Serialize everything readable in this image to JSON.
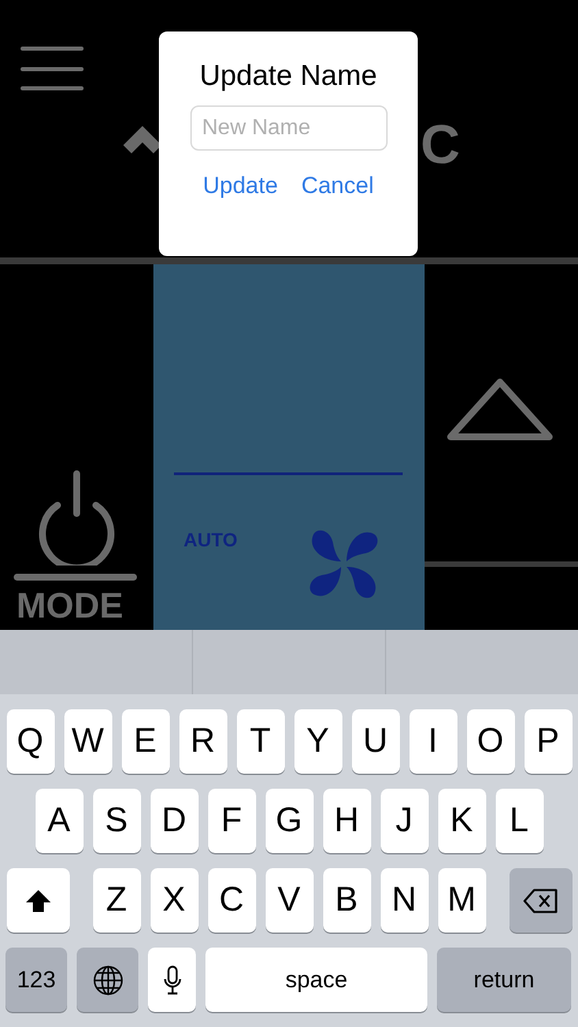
{
  "logo": {
    "text": "C"
  },
  "panel": {
    "mode_label": "MODE",
    "fan_mode": "AUTO"
  },
  "dialog": {
    "title": "Update Name",
    "field": {
      "placeholder": "New Name"
    },
    "buttons": [
      "Update",
      "Cancel"
    ]
  },
  "keyboard": {
    "row_1": [
      {
        "kind": "letter",
        "label": "Q"
      },
      {
        "kind": "letter",
        "label": "W"
      },
      {
        "kind": "letter",
        "label": "E"
      },
      {
        "kind": "letter",
        "label": "R"
      },
      {
        "kind": "letter",
        "label": "T"
      },
      {
        "kind": "letter",
        "label": "Y"
      },
      {
        "kind": "letter",
        "label": "U"
      },
      {
        "kind": "letter",
        "label": "I"
      },
      {
        "kind": "letter",
        "label": "O"
      },
      {
        "kind": "letter",
        "label": "P"
      }
    ],
    "row_2": [
      {
        "kind": "letter",
        "label": "A"
      },
      {
        "kind": "letter",
        "label": "S"
      },
      {
        "kind": "letter",
        "label": "D"
      },
      {
        "kind": "letter",
        "label": "F"
      },
      {
        "kind": "letter",
        "label": "G"
      },
      {
        "kind": "letter",
        "label": "H"
      },
      {
        "kind": "letter",
        "label": "J"
      },
      {
        "kind": "letter",
        "label": "K"
      },
      {
        "kind": "letter",
        "label": "L"
      }
    ],
    "row_3": [
      {
        "kind": "shift"
      },
      {
        "kind": "letter",
        "label": "Z"
      },
      {
        "kind": "letter",
        "label": "X"
      },
      {
        "kind": "letter",
        "label": "C"
      },
      {
        "kind": "letter",
        "label": "V"
      },
      {
        "kind": "letter",
        "label": "B"
      },
      {
        "kind": "letter",
        "label": "N"
      },
      {
        "kind": "letter",
        "label": "M"
      },
      {
        "kind": "delete"
      }
    ],
    "row_4": [
      {
        "kind": "mode",
        "label": "123"
      },
      {
        "kind": "globe"
      },
      {
        "kind": "mic"
      },
      {
        "kind": "space",
        "label": "space"
      },
      {
        "kind": "return",
        "label": "return"
      }
    ]
  }
}
